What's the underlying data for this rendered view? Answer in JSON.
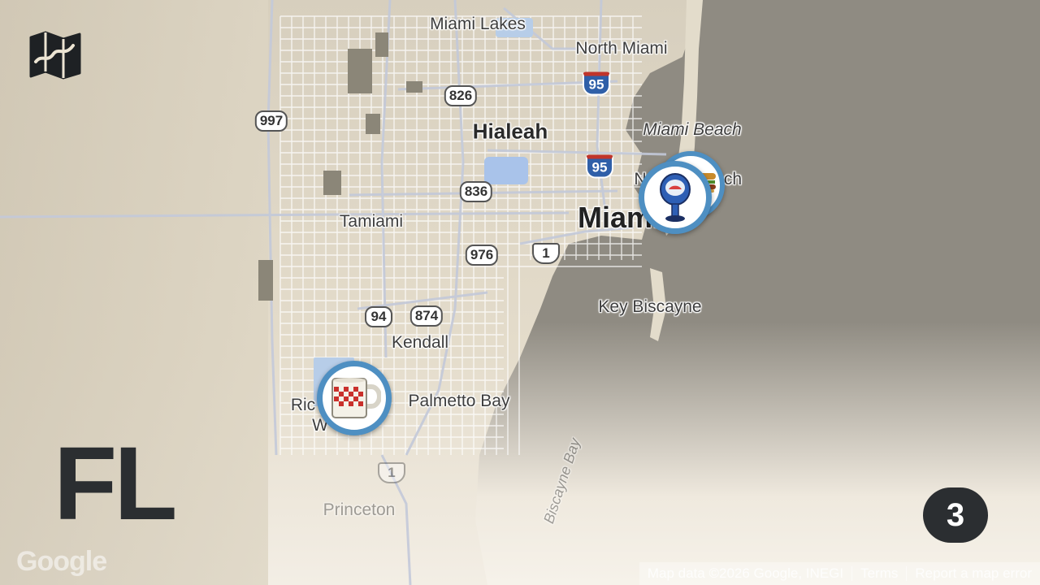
{
  "places": {
    "miami_lakes": "Miami Lakes",
    "north_miami": "North Miami",
    "hialeah": "Hialeah",
    "miami_beach": "Miami Beach",
    "north_beach_partial": "N",
    "north_beach_tail": "ch",
    "tamiami": "Tamiami",
    "miami": "Miami",
    "key_biscayne": "Key Biscayne",
    "kendall": "Kendall",
    "palmetto_bay": "Palmetto Bay",
    "richmond_partial": "Ric",
    "w_partial": "W",
    "princeton": "Princeton",
    "biscayne_bay": "Biscayne Bay"
  },
  "shields": {
    "r826": "826",
    "r997": "997",
    "i95_north": "95",
    "i95_south": "95",
    "r836": "836",
    "r976": "976",
    "us1_north": "1",
    "r94": "94",
    "r874": "874",
    "us1_south": "1"
  },
  "markers": {
    "diner_mug": "diner-mug-icon",
    "parking_meter": "parking-meter-icon",
    "food_stack": "food-icon"
  },
  "overlay": {
    "state_code": "FL",
    "count": "3"
  },
  "footer": {
    "google": "Google",
    "map_data": "Map data ©2026 Google, INEGI",
    "terms": "Terms",
    "report": "Report a map error"
  },
  "colors": {
    "land": "#ece4d3",
    "water": "#8f8b82",
    "marker_ring": "#4e8fc2",
    "badge": "#2b2e31"
  }
}
